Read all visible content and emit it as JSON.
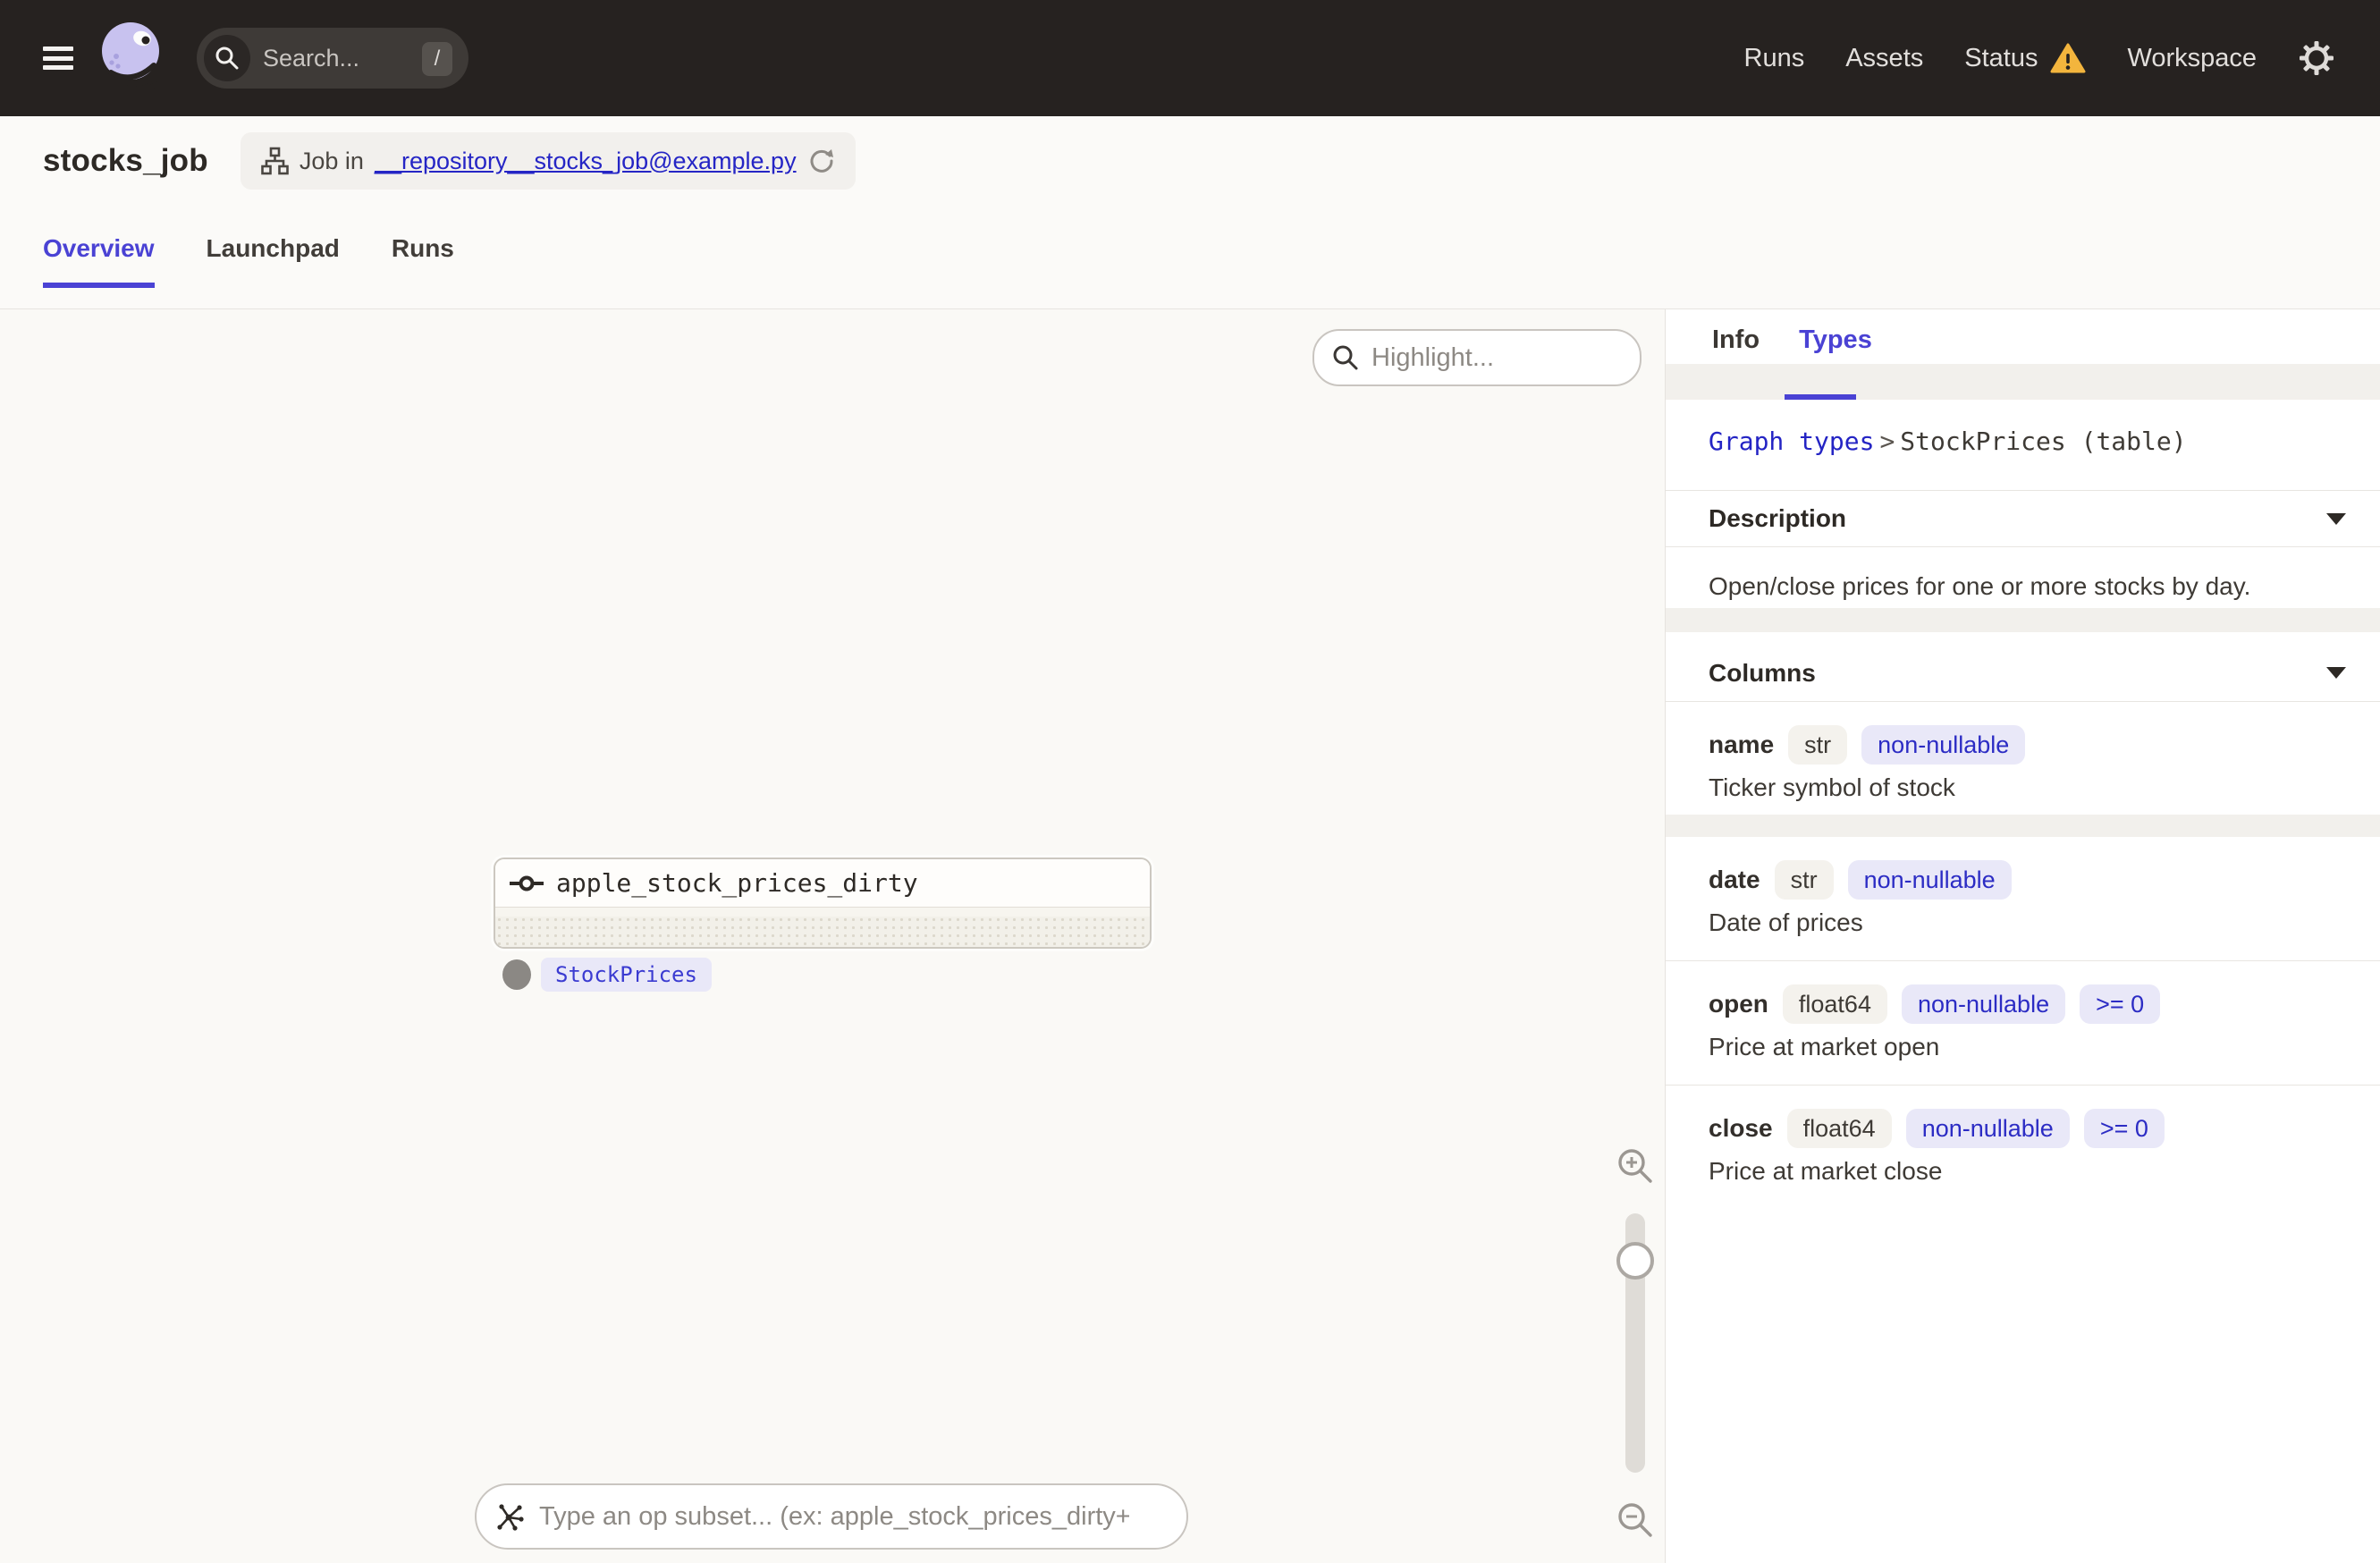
{
  "header": {
    "search_placeholder": "Search...",
    "search_shortcut": "/",
    "nav": {
      "runs": "Runs",
      "assets": "Assets",
      "status": "Status",
      "workspace": "Workspace"
    }
  },
  "page": {
    "title": "stocks_job",
    "job_pill": {
      "prefix": "Job in",
      "link": "__repository__stocks_job@example.py"
    },
    "tabs": {
      "overview": "Overview",
      "launchpad": "Launchpad",
      "runs": "Runs"
    }
  },
  "graph": {
    "highlight_placeholder": "Highlight...",
    "node": {
      "name": "apple_stock_prices_dirty",
      "output_type": "StockPrices"
    },
    "subset_placeholder": "Type an op subset... (ex: apple_stock_prices_dirty+)"
  },
  "panel": {
    "tabs": {
      "info": "Info",
      "types": "Types"
    },
    "breadcrumb": {
      "link": "Graph types",
      "separator": ">",
      "current": "StockPrices (table)"
    },
    "description": {
      "title": "Description",
      "text": "Open/close prices for one or more stocks by day."
    },
    "columns": {
      "title": "Columns",
      "rows": [
        {
          "name": "name",
          "badges": [
            {
              "label": "str"
            },
            {
              "label": "non-nullable"
            }
          ],
          "description": "Ticker symbol of stock"
        },
        {
          "name": "date",
          "badges": [
            {
              "label": "str"
            },
            {
              "label": "non-nullable"
            }
          ],
          "description": "Date of prices"
        },
        {
          "name": "open",
          "badges": [
            {
              "label": "float64"
            },
            {
              "label": "non-nullable"
            },
            {
              "label": ">= 0"
            }
          ],
          "description": "Price at market open"
        },
        {
          "name": "close",
          "badges": [
            {
              "label": "float64"
            },
            {
              "label": "non-nullable"
            },
            {
              "label": ">= 0"
            }
          ],
          "description": "Price at market close"
        }
      ]
    }
  },
  "colors": {
    "header_bg": "#262220",
    "accent": "#4A42D4",
    "link_blue": "#2424C4",
    "warning": "#F3B53D",
    "badge_purple_bg": "#E9E8F8",
    "badge_gray_bg": "#F4F2ED",
    "panel_bg": "#FFFFFF",
    "canvas_bg": "#FAF9F6"
  }
}
